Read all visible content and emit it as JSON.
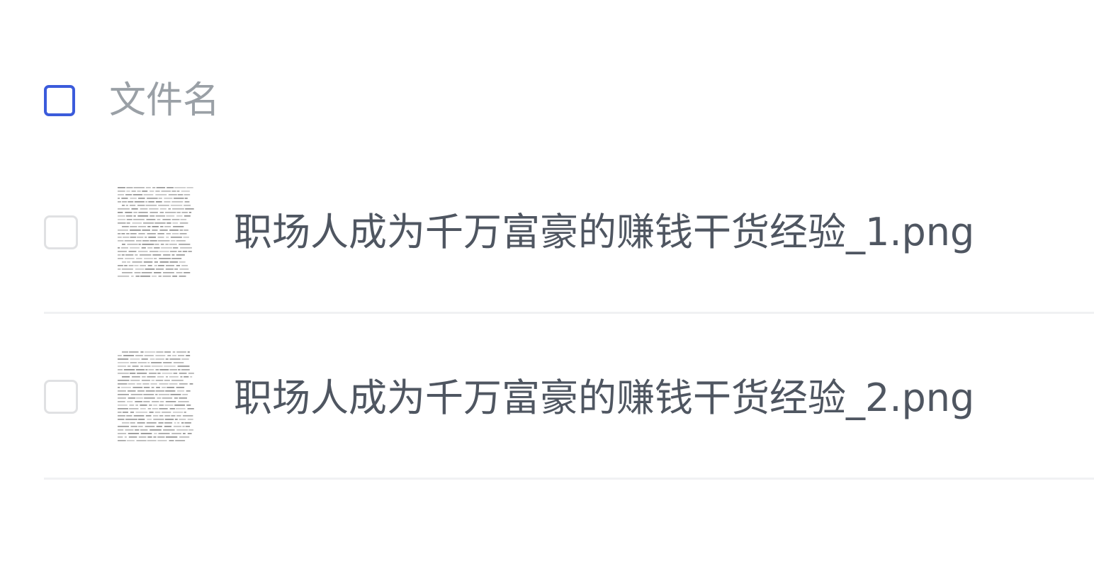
{
  "header": {
    "select_all_checked": false,
    "column_label": "文件名"
  },
  "files": [
    {
      "name": "职场人成为千万富豪的赚钱干货经验_1.png",
      "checked": false,
      "thumbnail_icon": "document-preview-icon"
    },
    {
      "name": "职场人成为千万富豪的赚钱干货经验_2.png",
      "checked": false,
      "thumbnail_icon": "document-preview-icon"
    }
  ],
  "colors": {
    "accent": "#3b5bdb",
    "header_text": "#9aa0a6",
    "file_text": "#4f5661",
    "divider": "#f0f1f3"
  }
}
